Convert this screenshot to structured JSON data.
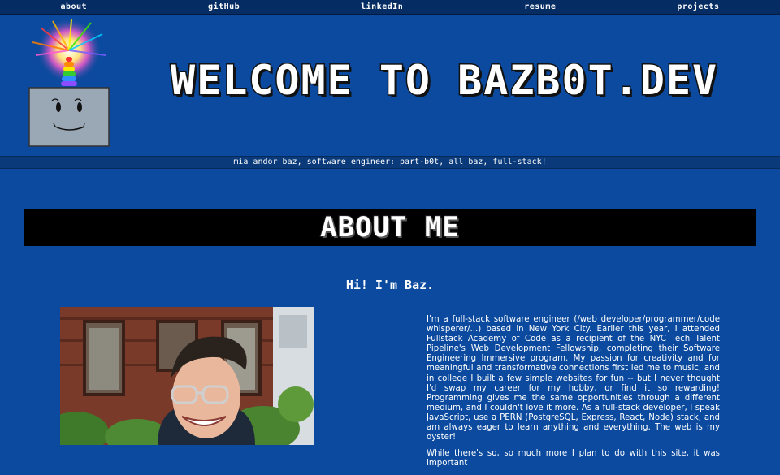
{
  "nav": {
    "about": "about",
    "github": "gitHub",
    "linkedin": "linkedIn",
    "resume": "resume",
    "projects": "projects"
  },
  "header": {
    "title": "WELCOME TO BAZB0T.DEV",
    "tagline": "mia andor baz, software engineer: part-b0t, all baz, full-stack!"
  },
  "about": {
    "heading": "ABOUT ME",
    "greeting": "Hi! I'm Baz.",
    "bio_paragraph_1": "I'm a full-stack software engineer (/web developer/programmer/code whisperer/...) based in New York City. Earlier this year, I attended Fullstack Academy of Code as a recipient of the NYC Tech Talent Pipeline's Web Development Fellowship, completing their Software Engineering Immersive program. My passion for creativity and for meaningful and transformative connections first led me to music, and in college I built a few simple websites for fun -- but I never thought I'd swap my career for my hobby, or find it so rewarding! Programming gives me the same opportunities through a different medium, and I couldn't love it more. As a full-stack developer, I speak JavaScript, use a PERN (PostgreSQL, Express, React, Node) stack, and am always eager to learn anything and everything. The web is my oyster!",
    "bio_paragraph_2": "While there's so, so much more I plan to do with this site, it was important"
  },
  "colors": {
    "background": "#0b4a9e",
    "nav": "#052c63",
    "band": "#000000",
    "text": "#ffffff"
  },
  "icons": [
    "robot-logo-icon"
  ]
}
